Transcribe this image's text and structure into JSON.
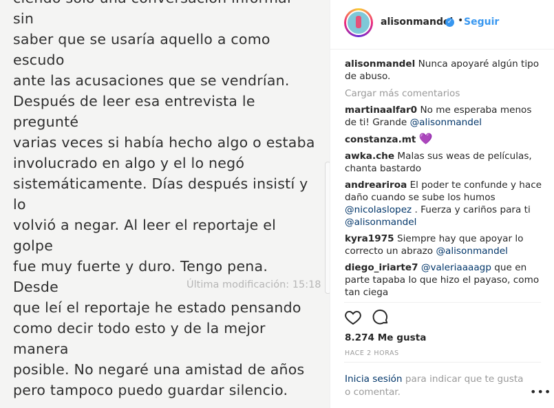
{
  "note": {
    "text": "ciendo solo una conversación informal sin\nsaber que se usaría aquello a como escudo\nante las acusaciones que se vendrían.\nDespués de leer esa entrevista le pregunté\nvarias veces si había hecho algo o estaba\ninvolucrado en algo y el lo negó\nsistemáticamente. Días después insistí y lo\nvolvió a negar. Al leer el reportaje el golpe\nfue muy fuerte y duro. Tengo pena. Desde\nque leí el reportaje he estado pensando\ncomo decir todo esto y de la mejor manera\nposible. No negaré una amistad de años\npero tampoco puedo guardar silencio.",
    "last_modified": "Última modificación: 15:18"
  },
  "header": {
    "username": "alisonmandel",
    "separator": "•",
    "follow_label": "Seguir"
  },
  "caption": {
    "user": "alisonmandel",
    "text": "Nunca apoyaré algún tipo de abuso."
  },
  "load_more": "Cargar más comentarios",
  "comments": [
    {
      "user": "martinaalfar0",
      "text": "No me esperaba menos de ti! Grande ",
      "mention": "@alisonmandel"
    },
    {
      "user": "constanza.mt",
      "text": "💜"
    },
    {
      "user": "awka.che",
      "text": "Malas sus weas de películas, chanta bastardo"
    },
    {
      "user": "andreariroa",
      "text": "El poder te confunde y hace daño cuando se sube los humos ",
      "mention": "@nicolaslopez",
      "text2": " . Fuerza y cariños para ti ",
      "mention2": "@alisonmandel"
    },
    {
      "user": "kyra1975",
      "text": "Siempre hay que apoyar lo correcto un abrazo ",
      "mention": "@alisonmandel"
    },
    {
      "user": "diego_iriarte7",
      "mention": "@valeriaaaagp",
      "text": " que en parte tapaba lo que hizo el payaso, como tan ciega"
    }
  ],
  "likes": "8.274 Me gusta",
  "time": "HACE 2 HORAS",
  "login": {
    "link": "Inicia sesión",
    "rest": " para indicar que te gusta o comentar."
  },
  "more_label": "•••",
  "colors": {
    "accent": "#3897f0",
    "mention": "#003569",
    "muted": "#999999"
  }
}
